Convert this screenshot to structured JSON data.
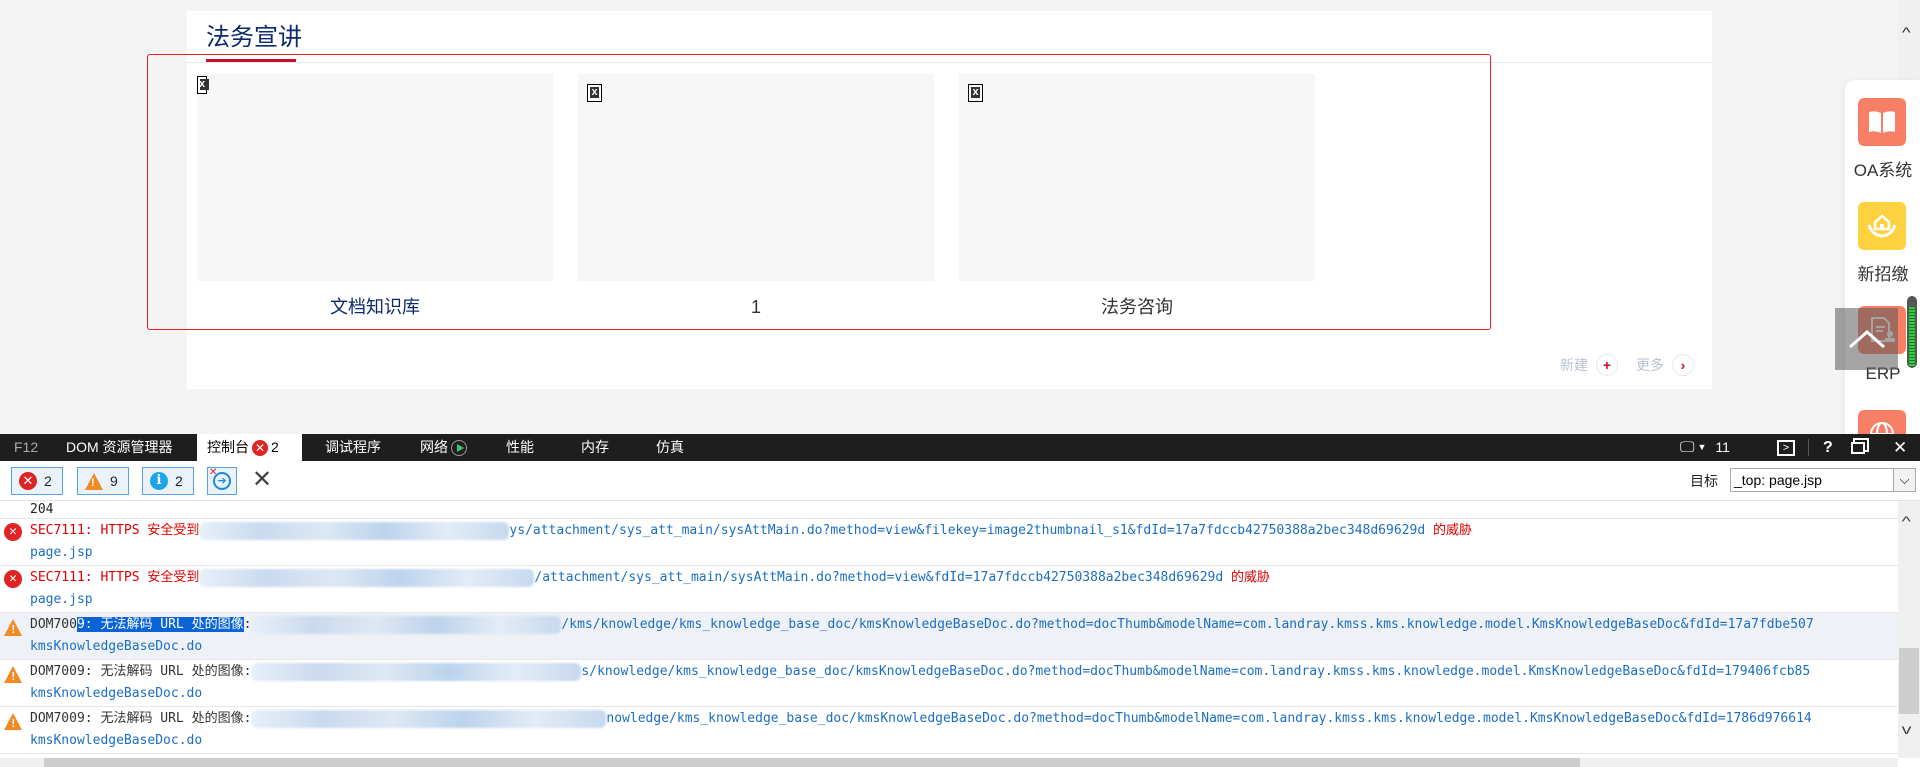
{
  "page": {
    "section_title": "法务宣讲",
    "cards": [
      {
        "label": "文档知识库",
        "label_color": "#0b2a6b"
      },
      {
        "label": "1",
        "label_color": "#333333"
      },
      {
        "label": "法务咨询",
        "label_color": "#333333"
      }
    ],
    "footer": {
      "new_label": "新建",
      "new_icon": "+",
      "more_label": "更多",
      "more_icon": "›"
    },
    "float_bar": [
      {
        "label": "OA系统",
        "icon": "book-icon",
        "color": "#f67f66"
      },
      {
        "label": "新招缴",
        "icon": "house-hands-icon",
        "color": "#fdd23e"
      },
      {
        "label": "ERP",
        "icon": "document-stamp-icon",
        "color": "#f67f66"
      },
      {
        "label": "",
        "icon": "globe-icon",
        "color": "#f67f66"
      }
    ],
    "colors": {
      "accent": "#c8102e",
      "title": "#0b2a6b",
      "focus_border": "#e8231f"
    }
  },
  "devtools": {
    "tabs": [
      {
        "label": "F12"
      },
      {
        "label": "DOM 资源管理器"
      },
      {
        "label": "控制台",
        "badge": "2",
        "active": true
      },
      {
        "label": "调试程序"
      },
      {
        "label": "网络"
      },
      {
        "label": "性能"
      },
      {
        "label": "内存"
      },
      {
        "label": "仿真"
      }
    ],
    "right": {
      "version": "11"
    },
    "filters": {
      "errors": "2",
      "warnings": "9",
      "info": "2"
    },
    "target": {
      "label": "目标",
      "value": "_top: page.jsp"
    },
    "console": {
      "first_line": "204",
      "entries": [
        {
          "type": "error",
          "code": "SEC7111",
          "msg": ": HTTPS 安全受到",
          "url": "ys/attachment/sys_att_main/sysAttMain.do?method=view&filekey=image2thumbnail_s1&fdId=17a7fdccb42750388a2bec348d69629d",
          "suffix": " 的威胁",
          "source": "page.jsp"
        },
        {
          "type": "error",
          "code": "SEC7111",
          "msg": ": HTTPS 安全受到",
          "url": "/attachment/sys_att_main/sysAttMain.do?method=view&fdId=17a7fdccb42750388a2bec348d69629d",
          "suffix": " 的威胁",
          "source": "page.jsp"
        },
        {
          "type": "warning",
          "code": "DOM700",
          "code_sel": "9",
          "msg": ": 无法解码 URL 处的图像",
          "url": "/kms/knowledge/kms_knowledge_base_doc/kmsKnowledgeBaseDoc.do?method=docThumb&modelName=com.landray.kmss.kms.knowledge.model.KmsKnowledgeBaseDoc&fdId=17a7fdbe507",
          "source": "kmsKnowledgeBaseDoc.do",
          "selected": true
        },
        {
          "type": "warning",
          "code": "DOM7009",
          "msg": ": 无法解码 URL 处的图像:",
          "url": "s/knowledge/kms_knowledge_base_doc/kmsKnowledgeBaseDoc.do?method=docThumb&modelName=com.landray.kmss.kms.knowledge.model.KmsKnowledgeBaseDoc&fdId=179406fcb85",
          "source": "kmsKnowledgeBaseDoc.do"
        },
        {
          "type": "warning",
          "code": "DOM7009",
          "msg": ": 无法解码 URL 处的图像:",
          "url": "nowledge/kms_knowledge_base_doc/kmsKnowledgeBaseDoc.do?method=docThumb&modelName=com.landray.kmss.kms.knowledge.model.KmsKnowledgeBaseDoc&fdId=1786d976614",
          "source": "kmsKnowledgeBaseDoc.do"
        }
      ]
    }
  }
}
